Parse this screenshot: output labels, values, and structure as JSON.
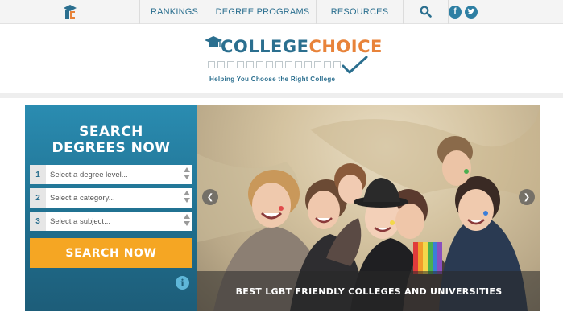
{
  "nav": {
    "items": [
      "RANKINGS",
      "DEGREE PROGRAMS",
      "RESOURCES"
    ],
    "search_icon": "search-icon",
    "social": [
      "facebook-icon",
      "twitter-icon"
    ]
  },
  "brand": {
    "college": "COLLEGE",
    "choice": "CHOICE",
    "tagline": "Helping You Choose the Right College"
  },
  "search": {
    "title_line1": "SEARCH",
    "title_line2": "DEGREES NOW",
    "fields": [
      {
        "number": "1",
        "placeholder": "Select a degree level..."
      },
      {
        "number": "2",
        "placeholder": "Select a category..."
      },
      {
        "number": "3",
        "placeholder": "Select a subject..."
      }
    ],
    "button_label": "SEARCH NOW",
    "info_symbol": "i"
  },
  "hero": {
    "caption": "BEST LGBT FRIENDLY COLLEGES AND UNIVERSITIES",
    "prev_symbol": "❮",
    "next_symbol": "❯"
  },
  "colors": {
    "primary": "#2b6f8f",
    "accent": "#e8833a",
    "button": "#f5a623"
  }
}
